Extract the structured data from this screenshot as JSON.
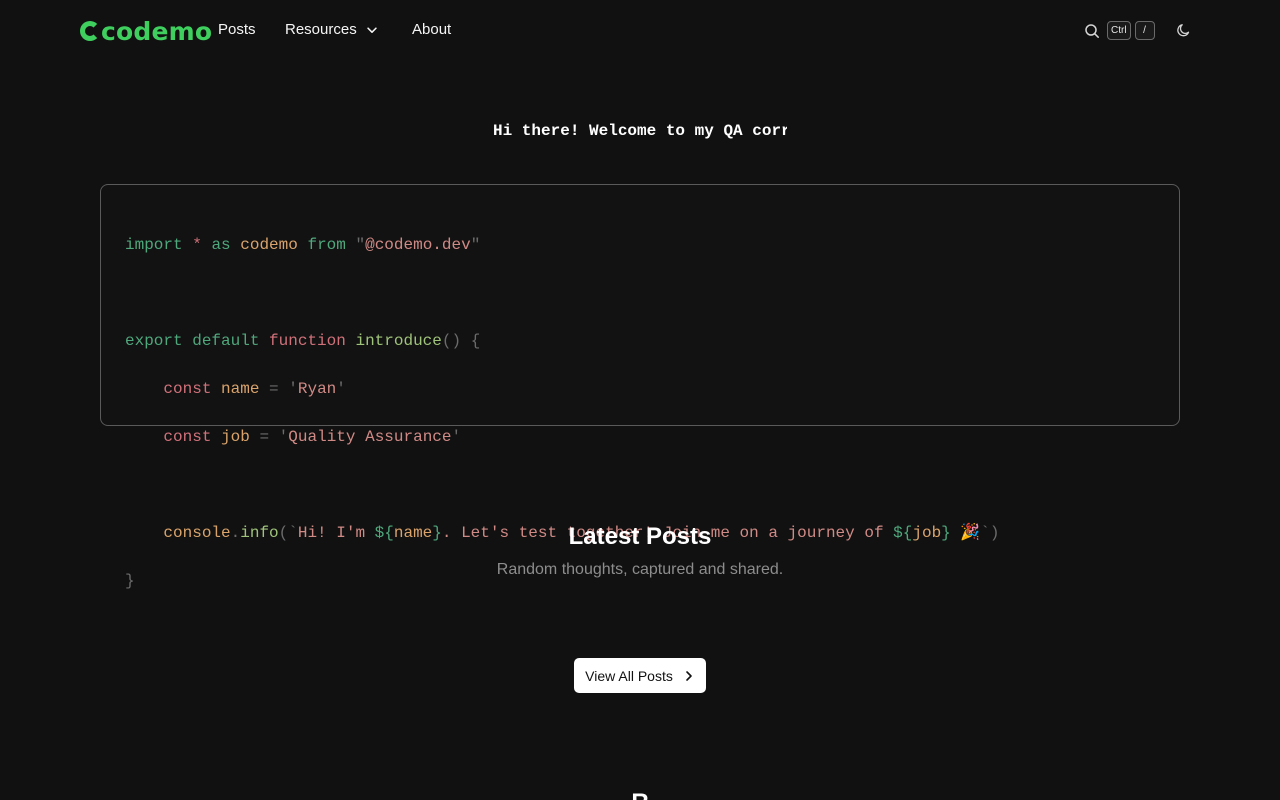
{
  "nav": {
    "logo": "codemo",
    "links": [
      "Posts",
      "Resources",
      "About"
    ],
    "kbd_ctrl": "Ctrl",
    "kbd_slash": "/"
  },
  "hero": {
    "typed_text": "Hi there! Welcome to my QA corr"
  },
  "code": {
    "import_kw": "import",
    "star": "*",
    "as_kw": "as",
    "module_name": "codemo",
    "from_kw": "from",
    "module_path": "@codemo.dev",
    "export_kw": "export",
    "default_kw": "default",
    "function_kw": "function",
    "fn_name": "introduce",
    "const_kw": "const",
    "var_name": "name",
    "name_value": "Ryan",
    "var_job": "job",
    "job_value": "Quality Assurance",
    "console": "console",
    "info": "info",
    "tpl_part1": "Hi! I'm ",
    "tpl_part2": ". Let's test together! Join me on a journey of ",
    "emoji": "🎉"
  },
  "latest": {
    "title": "Latest Posts",
    "subtitle": "Random thoughts, captured and shared.",
    "button": "View All Posts"
  },
  "next_section": {
    "partial_title": "R"
  }
}
